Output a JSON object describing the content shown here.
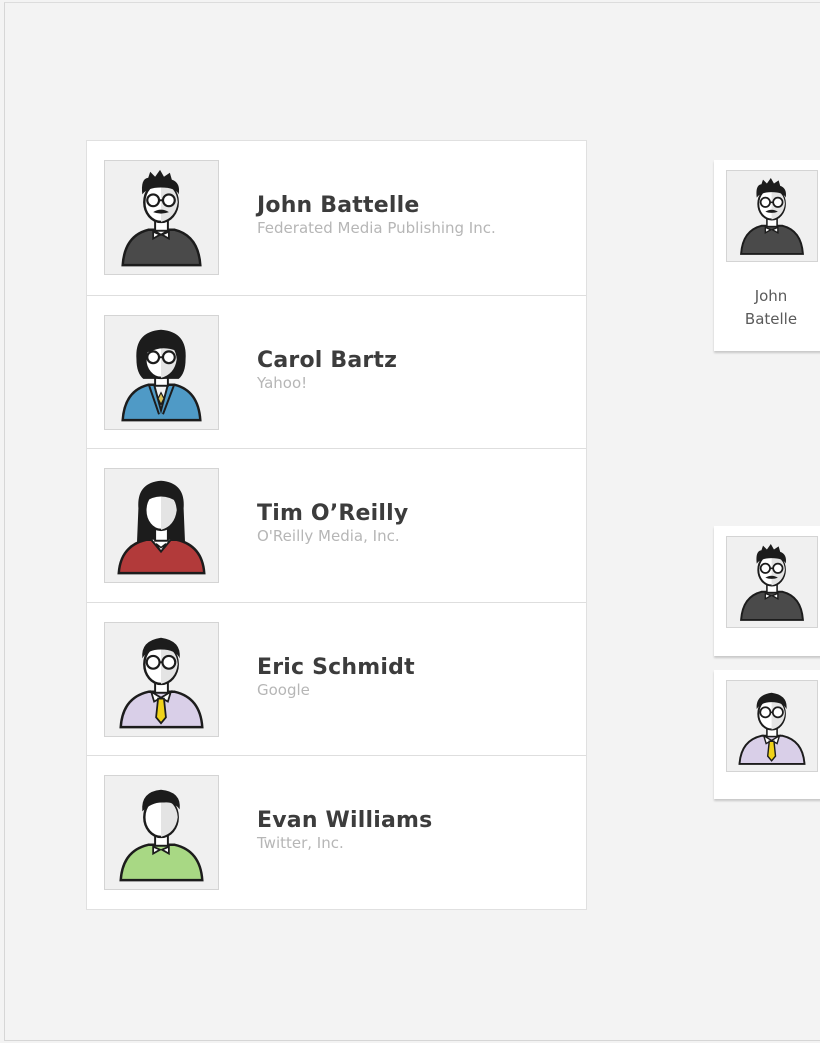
{
  "people": [
    {
      "name": "John Battelle",
      "company": "Federated Media Publishing Inc.",
      "avatar": "avatar-dark-bowtie-mustache",
      "shirt_color": "#4a4a4a"
    },
    {
      "name": "Carol Bartz",
      "company": "Yahoo!",
      "avatar": "avatar-blue-jacket",
      "shirt_color": "#4f9ac6"
    },
    {
      "name": "Tim O’Reilly",
      "company": "O'Reilly Media, Inc.",
      "avatar": "avatar-red-sweater",
      "shirt_color": "#b23a3a"
    },
    {
      "name": "Eric Schmidt",
      "company": "Google",
      "avatar": "avatar-lavender-tie",
      "shirt_color": "#d9cfe8"
    },
    {
      "name": "Evan Williams",
      "company": "Twitter, Inc.",
      "avatar": "avatar-green-bowtie",
      "shirt_color": "#a8d884"
    }
  ],
  "side_cards": [
    {
      "label_line1": "John",
      "label_line2": "Batelle",
      "avatar": "avatar-dark-bowtie-mustache"
    },
    {
      "avatar": "avatar-dark-bowtie-mustache"
    },
    {
      "avatar": "avatar-lavender-tie"
    }
  ]
}
